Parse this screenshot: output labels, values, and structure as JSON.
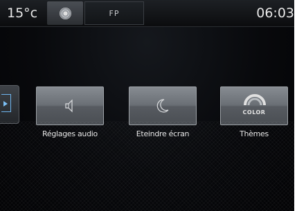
{
  "statusbar": {
    "temperature": "15°c",
    "fp_label": "FP",
    "clock": "06:03"
  },
  "tiles": [
    {
      "label": "Réglages audio",
      "icon": "speaker-icon"
    },
    {
      "label": "Eteindre écran",
      "icon": "moon-icon"
    },
    {
      "label": "Thèmes",
      "icon": "color-palette-icon",
      "icon_text": "COLOR"
    }
  ],
  "colors": {
    "accent_blue": "#6fb6f0",
    "tile_top": "#868b91",
    "tile_bottom": "#4a4e53",
    "background": "#08090c"
  }
}
